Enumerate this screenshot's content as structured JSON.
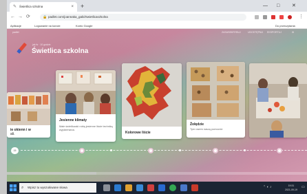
{
  "browser": {
    "tab_title": "Świetlica szkolna",
    "new_tab": "+",
    "url": "padlet.com/joannaka_gabi/Swietlicaszkolna",
    "bookmarks": [
      "Aplikacje",
      "Logowanie na koncie",
      "Konto Google",
      "Do przeczytania"
    ],
    "window_controls": [
      "—",
      "□",
      "✕"
    ]
  },
  "padlet": {
    "top_actions": [
      "ZASUBSKRYBUJ",
      "UDOSTĘPNIJ",
      "EKSPORTUJ"
    ],
    "author": "jak fs · 10 godzin",
    "title": "Świetlica szkolna",
    "cards": [
      {
        "title": "ie okienn i w",
        "subtitle": "ali."
      },
      {
        "title": "Jesienne klimaty",
        "body": "Małe świetliczaki robią jesienne liście techniką wyjdzieniana."
      },
      {
        "title": "Kolorowe liście",
        "body": ""
      },
      {
        "title": "Żołędzie",
        "body": "Tym razem naszą pomocnie"
      }
    ],
    "timeline_start": "15"
  },
  "taskbar": {
    "search_placeholder": "Wpisz tu wyszukiwane słowa",
    "time": "19:31",
    "date": "2021-09-19"
  },
  "colors": {
    "accent": "#c98fa0",
    "teal": "#7fae9c"
  }
}
